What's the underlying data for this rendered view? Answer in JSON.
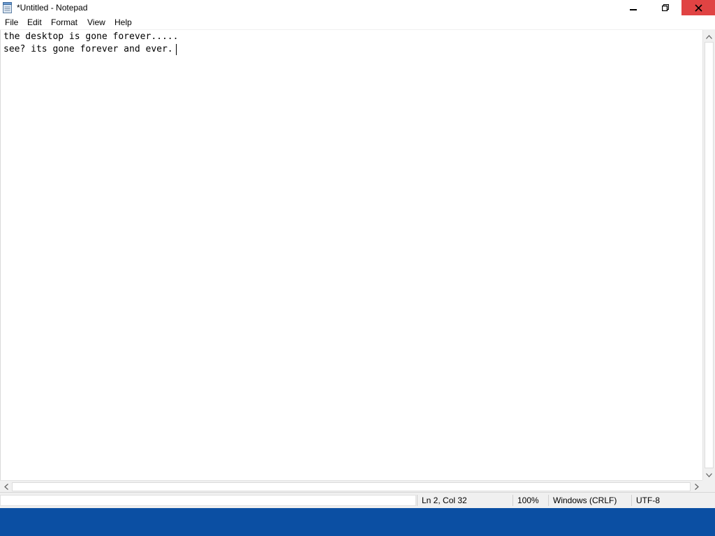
{
  "window": {
    "title": "*Untitled - Notepad",
    "app_icon": "notepad-icon",
    "close_color": "#e04343"
  },
  "menu": [
    {
      "label": "File"
    },
    {
      "label": "Edit"
    },
    {
      "label": "Format"
    },
    {
      "label": "View"
    },
    {
      "label": "Help"
    }
  ],
  "editor": {
    "lines": [
      "the desktop is gone forever.....",
      "see? its gone forever and ever."
    ]
  },
  "status": {
    "position": "Ln 2, Col 32",
    "zoom": "100%",
    "line_ending": "Windows (CRLF)",
    "encoding": "UTF-8"
  },
  "taskbar": {
    "color": "#0b4fa3"
  }
}
